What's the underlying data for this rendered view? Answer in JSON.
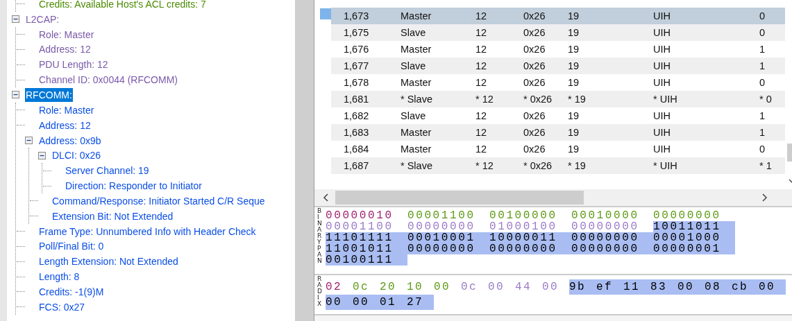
{
  "tree": {
    "cut_branch": [
      {
        "label": "Credits: Available Host's ACL credits: 7",
        "color": "#4a8a00",
        "selected": false
      }
    ],
    "nodes": [
      {
        "label": "L2CAP:",
        "color": "#7a5aaa",
        "expanded": true,
        "selected": false,
        "children": [
          {
            "label": "Role: Master",
            "color": "#7a5aaa",
            "selected": false
          },
          {
            "label": "Address: 12",
            "color": "#7a5aaa",
            "selected": false
          },
          {
            "label": "PDU Length: 12",
            "color": "#7a5aaa",
            "selected": false
          },
          {
            "label": "Channel ID: 0x0044  (RFCOMM)",
            "color": "#7a5aaa",
            "selected": false
          }
        ]
      },
      {
        "label": "RFCOMM:",
        "expanded": true,
        "selected": true,
        "children": [
          {
            "label": "Role: Master",
            "color": "#0a4ee6",
            "selected": false
          },
          {
            "label": "Address: 12",
            "color": "#0a4ee6",
            "selected": false
          },
          {
            "label": "Address: 0x9b",
            "color": "#0a4ee6",
            "expanded": true,
            "selected": false,
            "children": [
              {
                "label": "DLCI: 0x26",
                "color": "#0a4ee6",
                "expanded": true,
                "selected": false,
                "children": [
                  {
                    "label": "Server Channel: 19",
                    "color": "#0a4ee6",
                    "selected": false
                  },
                  {
                    "label": "Direction: Responder to Initiator",
                    "color": "#0a4ee6",
                    "selected": false
                  }
                ]
              },
              {
                "label": "Command/Response: Initiator Started C/R Seque",
                "color": "#0a4ee6",
                "selected": false
              },
              {
                "label": "Extension Bit: Not Extended",
                "color": "#0a4ee6",
                "selected": false
              }
            ]
          },
          {
            "label": "Frame Type: Unnumbered Info with Header Check",
            "color": "#0a4ee6",
            "selected": false
          },
          {
            "label": "Poll/Final Bit: 0",
            "color": "#0a4ee6",
            "selected": false
          },
          {
            "label": "Length Extension: Not Extended",
            "color": "#0a4ee6",
            "selected": false
          },
          {
            "label": "Length: 8",
            "color": "#0a4ee6",
            "selected": false
          },
          {
            "label": "Credits: -1(9)M",
            "color": "#0a4ee6",
            "selected": false
          },
          {
            "label": "FCS: 0x27",
            "color": "#0a4ee6",
            "selected": false
          }
        ]
      }
    ]
  },
  "table": {
    "rows": [
      {
        "selected": true,
        "cells": [
          "1,673",
          "Master",
          "12",
          "0x26",
          "19",
          "UIH",
          "0"
        ]
      },
      {
        "selected": false,
        "cells": [
          "1,675",
          "Slave",
          "12",
          "0x26",
          "19",
          "UIH",
          "0"
        ]
      },
      {
        "selected": false,
        "cells": [
          "1,676",
          "Master",
          "12",
          "0x26",
          "19",
          "UIH",
          "1"
        ]
      },
      {
        "selected": false,
        "cells": [
          "1,677",
          "Slave",
          "12",
          "0x26",
          "19",
          "UIH",
          "1"
        ]
      },
      {
        "selected": false,
        "cells": [
          "1,678",
          "Master",
          "12",
          "0x26",
          "19",
          "UIH",
          "0"
        ]
      },
      {
        "selected": false,
        "cells": [
          "1,681",
          "* Slave",
          "* 12",
          "* 0x26",
          "* 19",
          "* UIH",
          "* 0"
        ]
      },
      {
        "selected": false,
        "cells": [
          "1,682",
          "Slave",
          "12",
          "0x26",
          "19",
          "UIH",
          "1"
        ]
      },
      {
        "selected": false,
        "cells": [
          "1,683",
          "Master",
          "12",
          "0x26",
          "19",
          "UIH",
          "1"
        ]
      },
      {
        "selected": false,
        "cells": [
          "1,684",
          "Master",
          "12",
          "0x26",
          "19",
          "UIH",
          "0"
        ]
      },
      {
        "selected": false,
        "cells": [
          "1,687",
          "* Slave",
          "* 12",
          "* 0x26",
          "* 19",
          "* UIH",
          "* 1"
        ]
      }
    ]
  },
  "binary_pane": {
    "label": "BINARY PAN"
  },
  "radix_pane": {
    "label": "RADIX"
  },
  "bytes": [
    {
      "hex": "02",
      "binary": "00000010",
      "color": "#a0206e",
      "selected": false
    },
    {
      "hex": "0c",
      "binary": "00001100",
      "color": "#5c9a14",
      "selected": false
    },
    {
      "hex": "20",
      "binary": "00100000",
      "color": "#5c9a14",
      "selected": false
    },
    {
      "hex": "10",
      "binary": "00010000",
      "color": "#5c9a14",
      "selected": false
    },
    {
      "hex": "00",
      "binary": "00000000",
      "color": "#5c9a14",
      "selected": false
    },
    {
      "hex": "0c",
      "binary": "00001100",
      "color": "#9a7ac8",
      "selected": false
    },
    {
      "hex": "00",
      "binary": "00000000",
      "color": "#9a7ac8",
      "selected": false
    },
    {
      "hex": "44",
      "binary": "01000100",
      "color": "#9a7ac8",
      "selected": false
    },
    {
      "hex": "00",
      "binary": "00000000",
      "color": "#9a7ac8",
      "selected": false
    },
    {
      "hex": "9b",
      "binary": "10011011",
      "selected": true
    },
    {
      "hex": "ef",
      "binary": "11101111",
      "selected": true
    },
    {
      "hex": "11",
      "binary": "00010001",
      "selected": true
    },
    {
      "hex": "83",
      "binary": "10000011",
      "selected": true
    },
    {
      "hex": "00",
      "binary": "00000000",
      "selected": true
    },
    {
      "hex": "08",
      "binary": "00001000",
      "selected": true
    },
    {
      "hex": "cb",
      "binary": "11001011",
      "selected": true
    },
    {
      "hex": "00",
      "binary": "00000000",
      "selected": true
    },
    {
      "hex": "00",
      "binary": "00000000",
      "selected": true
    },
    {
      "hex": "00",
      "binary": "00000000",
      "selected": true
    },
    {
      "hex": "01",
      "binary": "00000001",
      "selected": true
    },
    {
      "hex": "27",
      "binary": "00100111",
      "selected": true
    }
  ]
}
